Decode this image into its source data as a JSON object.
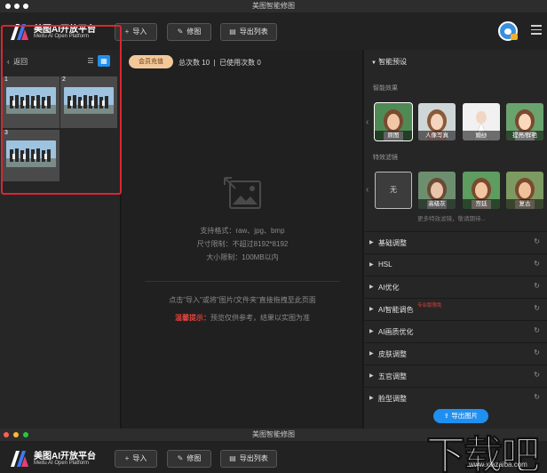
{
  "window": {
    "title": "美图智能修图",
    "title_bottom": "美图智能修图"
  },
  "brand": {
    "name": "美图AI开放平台",
    "subtitle": "Meitu AI Open Platform"
  },
  "toolbar": {
    "import_label": "导入",
    "retouch_label": "修图",
    "export_list_label": "导出列表"
  },
  "left_panel": {
    "back_label": "返回",
    "thumbnails": [
      {
        "index": "1"
      },
      {
        "index": "2"
      },
      {
        "index": "3"
      }
    ]
  },
  "center_panel": {
    "vip_label": "会员充值",
    "total_count": "总次数 10",
    "separator": "|",
    "used_count": "已使用次数 0",
    "formats": "支持格式：raw、jpg、bmp",
    "size_limit": "尺寸限制：不超过8192*8192",
    "file_limit": "大小限制：100MB以内",
    "drop_hint": "点击\"导入\"或将\"图片/文件夹\"直接拖拽至此页面",
    "warn_title": "温馨提示：",
    "warn_text": "预览仅供参考，结果以实图为准"
  },
  "right_panel": {
    "preset_title": "智能预设",
    "smart_effect_title": "智能效果",
    "effects": [
      {
        "label": "原图"
      },
      {
        "label": "人像写真"
      },
      {
        "label": "婚纱"
      },
      {
        "label": "提亮/鲜艳"
      }
    ],
    "filter_title": "特效滤镜",
    "filters": [
      {
        "label": "无"
      },
      {
        "label": "高级灰"
      },
      {
        "label": "宫廷"
      },
      {
        "label": "复古"
      }
    ],
    "more_note": "更多特效滤镜，敬请期待...",
    "sections": [
      {
        "label": "基础调整",
        "badge": ""
      },
      {
        "label": "HSL",
        "badge": ""
      },
      {
        "label": "AI优化",
        "badge": ""
      },
      {
        "label": "AI智能调色",
        "badge": "专业版限免"
      },
      {
        "label": "AI画质优化",
        "badge": ""
      },
      {
        "label": "皮肤调整",
        "badge": ""
      },
      {
        "label": "五官调整",
        "badge": ""
      },
      {
        "label": "脸型调整",
        "badge": ""
      }
    ],
    "export_image_label": "导出图片"
  },
  "watermark": {
    "text": "下载吧",
    "url": "www.xiazaiba.com"
  },
  "colors": {
    "accent_blue": "#1f8ff0",
    "highlight_red": "#d7282f",
    "vip_gold": "#f2c79a",
    "warn_red": "#e0403a"
  }
}
